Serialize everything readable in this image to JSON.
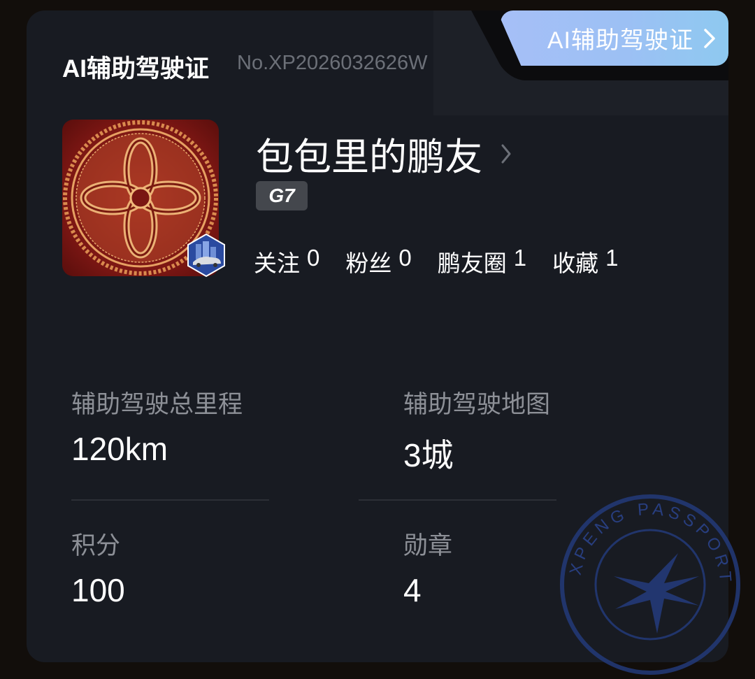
{
  "header": {
    "title": "AI辅助驾驶证",
    "serial": "No.XP2026032626W",
    "tab_label": "AI辅助驾驶证"
  },
  "profile": {
    "username": "包包里的鹏友",
    "car_model": "G7",
    "stats": [
      {
        "label": "关注",
        "value": "0"
      },
      {
        "label": "粉丝",
        "value": "0"
      },
      {
        "label": "鹏友圈",
        "value": "1"
      },
      {
        "label": "收藏",
        "value": "1"
      }
    ]
  },
  "metrics": [
    {
      "label": "辅助驾驶总里程",
      "value": "120km"
    },
    {
      "label": "辅助驾驶地图",
      "value": "3城"
    },
    {
      "label": "积分",
      "value": "100"
    },
    {
      "label": "勋章",
      "value": "4"
    }
  ],
  "stamp": {
    "text": "XPENG PASSPORT"
  },
  "colors": {
    "background": "#120e0b",
    "card": "#181b22",
    "tab_gradient_start": "#a6bff7",
    "tab_gradient_end": "#8ec9f0",
    "label_gray": "#8d9097",
    "avatar_red": "#8b1a16",
    "stamp_blue": "#233a7a"
  }
}
